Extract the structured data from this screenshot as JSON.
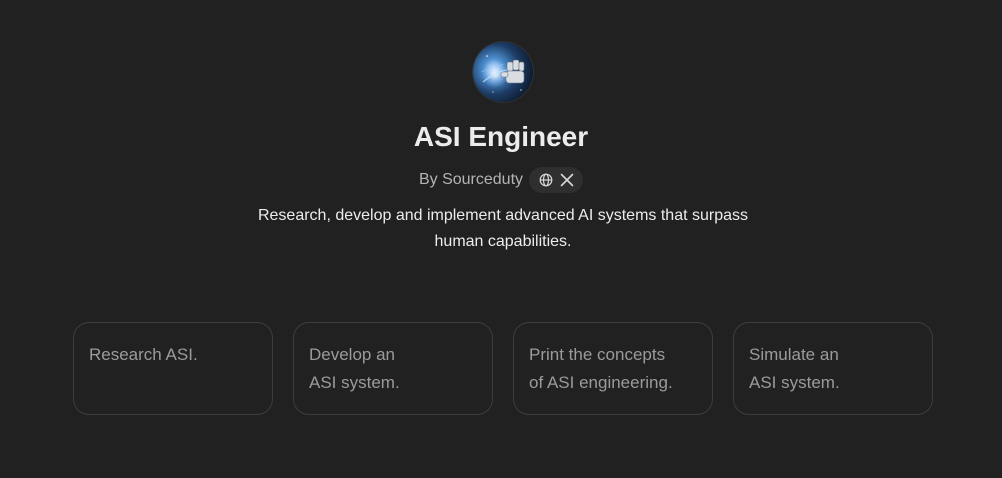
{
  "gpt": {
    "name": "ASI Engineer",
    "by_label": "By Sourceduty",
    "description": "Research, develop and implement advanced AI systems that surpass human capabilities.",
    "social_icons": [
      "globe-icon",
      "x-icon"
    ]
  },
  "conversation_starters": [
    {
      "label": "Research ASI."
    },
    {
      "label": "Develop an\nASI system."
    },
    {
      "label": "Print the concepts\nof ASI engineering."
    },
    {
      "label": "Simulate an\nASI system."
    }
  ],
  "colors": {
    "background": "#212121",
    "title": "#ececec",
    "byline": "#b4b4b4",
    "card_border": "#3d3d3d",
    "card_text": "#9b9b9b"
  }
}
